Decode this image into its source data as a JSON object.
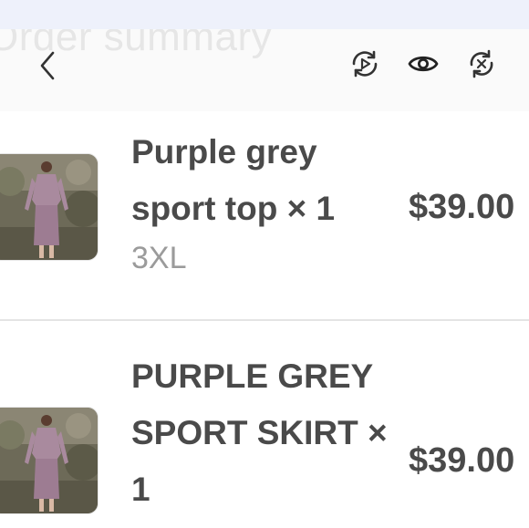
{
  "header": {
    "title": "Order summary",
    "back_icon": "chevron-left-icon",
    "actions": [
      {
        "icon": "replay-icon"
      },
      {
        "icon": "eye-icon"
      },
      {
        "icon": "refresh-icon"
      }
    ]
  },
  "items": [
    {
      "name": "Purple grey sport top × 1",
      "variant": "3XL",
      "price": "$39.00",
      "image": "product-photo"
    },
    {
      "name": "PURPLE GREY SPORT SKIRT × 1",
      "variant": "",
      "price": "$39.00",
      "image": "product-photo"
    }
  ],
  "colors": {
    "text": "#4a4a4a",
    "muted": "#9b9b9b",
    "header_bg": "#fafafa",
    "status_bg": "#eef1fb"
  }
}
